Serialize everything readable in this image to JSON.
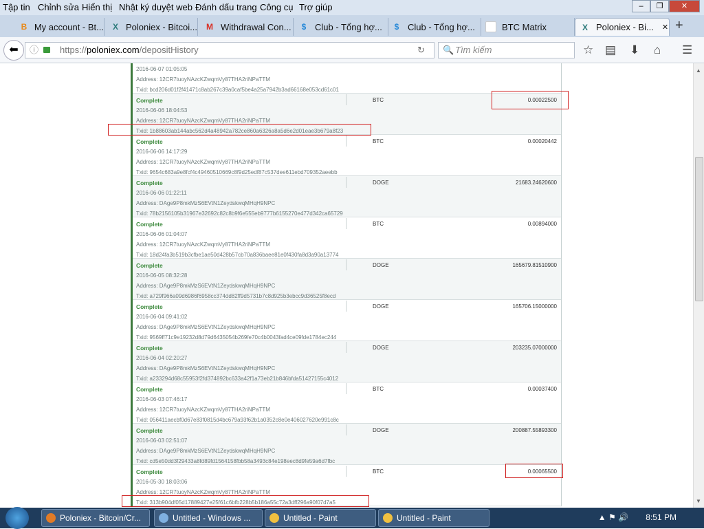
{
  "menu": [
    "Tập tin",
    "Chỉnh sửa",
    "Hiển thị",
    "Nhật ký duyệt web",
    "Đánh dấu trang",
    "Công cụ",
    "Trợ giúp"
  ],
  "tabs": [
    {
      "label": "My account - Bt...",
      "icon": "B",
      "color": "#e88a1a"
    },
    {
      "label": "Poloniex - Bitcoi...",
      "icon": "X",
      "color": "#2c7a7a"
    },
    {
      "label": "Withdrawal Con...",
      "icon": "M",
      "color": "#d93025"
    },
    {
      "label": "Club - Tổng hợ...",
      "icon": "$",
      "color": "#2a8ad8"
    },
    {
      "label": "Club - Tổng hợ...",
      "icon": "$",
      "color": "#2a8ad8"
    },
    {
      "label": "BTC Matrix",
      "icon": "",
      "color": "#ffffff"
    },
    {
      "label": "Poloniex - Bi...",
      "icon": "X",
      "color": "#2c7a7a"
    }
  ],
  "url": {
    "prefix": "https://",
    "host": "poloniex.com",
    "path": "/depositHistory"
  },
  "search_placeholder": "Tìm kiếm",
  "deposits": [
    {
      "status": "",
      "currency": "",
      "amount": "",
      "date": "2016-06-07   01:05:05",
      "address": "Address: 12CR7tuoyNAzcKZwqmVy87THA2riNPaTTM",
      "txid": "Txid: bcd206d01f2f41471c8ab267c39a0caf5be4a25a7942b3ad66168e053cd61c01"
    },
    {
      "status": "Complete",
      "currency": "BTC",
      "amount": "0.00022500",
      "date": "2016-06-06   18:04:53",
      "address": "Address: 12CR7tuoyNAzcKZwqmVy87THA2riNPaTTM",
      "txid": "Txid: 1b88603ab144abc562d4a48942a782ce860a6326a8a5d6e2d01eae3b679a8f23"
    },
    {
      "status": "Complete",
      "currency": "BTC",
      "amount": "0.00020442",
      "date": "2016-06-06   14:17:29",
      "address": "Address: 12CR7tuoyNAzcKZwqmVy87THA2riNPaTTM",
      "txid": "Txid: 9654c683a9e8fcf4c49460510669c8f9d25edf87c537dee611ebd709352aeebb"
    },
    {
      "status": "Complete",
      "currency": "DOGE",
      "amount": "21683.24620600",
      "date": "2016-06-06   01:22:11",
      "address": "Address: DAge9P8mkMzS6EVtN1ZeydskwqMHqH9NPC",
      "txid": "Txid: 78b2156105b31967e32692c82c8b9f6e555eb9777b6155270e477d342ca65729"
    },
    {
      "status": "Complete",
      "currency": "BTC",
      "amount": "0.00894000",
      "date": "2016-06-06   01:04:07",
      "address": "Address: 12CR7tuoyNAzcKZwqmVy87THA2riNPaTTM",
      "txid": "Txid: 18d24fa3b519b3cfbe1ae50d428b57cb70a836baee81e0f430fa8d3a90a13774"
    },
    {
      "status": "Complete",
      "currency": "DOGE",
      "amount": "165679.81510900",
      "date": "2016-06-05   08:32:28",
      "address": "Address: DAge9P8mkMzS6EVtN1ZeydskwqMHqH9NPC",
      "txid": "Txid: a729f966a09d6986f6958cc374dd82ff9d5731b7c8d925b3ebcc9d36525f8ecd"
    },
    {
      "status": "Complete",
      "currency": "DOGE",
      "amount": "165706.15000000",
      "date": "2016-06-04   09:41:02",
      "address": "Address: DAge9P8mkMzS6EVtN1ZeydskwqMHqH9NPC",
      "txid": "Txid: 9569ff71c9e19232d8d79d6435054b269fe70c4b0043fad4ce09fde1784ec244"
    },
    {
      "status": "Complete",
      "currency": "DOGE",
      "amount": "203235.07000000",
      "date": "2016-06-04   02:20:27",
      "address": "Address: DAge9P8mkMzS6EVtN1ZeydskwqMHqH9NPC",
      "txid": "Txid: a233294d68c55953f2fd374892bc633a42f1a73eb21b846bfda51427155c4012"
    },
    {
      "status": "Complete",
      "currency": "BTC",
      "amount": "0.00037400",
      "date": "2016-06-03   07:46:17",
      "address": "Address: 12CR7tuoyNAzcKZwqmVy87THA2riNPaTTM",
      "txid": "Txid: 056411aecbf0d67e83f0815d4bc679a93f62b1a0352c8e0e406027620e991c8c"
    },
    {
      "status": "Complete",
      "currency": "DOGE",
      "amount": "200887.55893300",
      "date": "2016-06-03   02:51:07",
      "address": "Address: DAge9P8mkMzS6EVtN1ZeydskwqMHqH9NPC",
      "txid": "Txid: cd5e50dd3f29433a8fd89fd1564158fbb58a3493c84e198eec8d9fe59a6d7fbc"
    },
    {
      "status": "Complete",
      "currency": "BTC",
      "amount": "0.00065500",
      "date": "2016-05-30   18:03:06",
      "address": "Address: 12CR7tuoyNAzcKZwqmVy87THA2riNPaTTM",
      "txid": "Txid: 313b904df05d17889427e25f61c6bfb228b5b186a55c72a3dff296a90f07d7a5"
    }
  ],
  "taskbar": [
    {
      "label": "Poloniex - Bitcoin/Cr...",
      "color": "#e07b27"
    },
    {
      "label": "Untitled - Windows ...",
      "color": "#7fb0e0"
    },
    {
      "label": "Untitled - Paint",
      "color": "#f0c040"
    },
    {
      "label": "Untitled - Paint",
      "color": "#f0c040"
    }
  ],
  "clock": "8:51 PM"
}
